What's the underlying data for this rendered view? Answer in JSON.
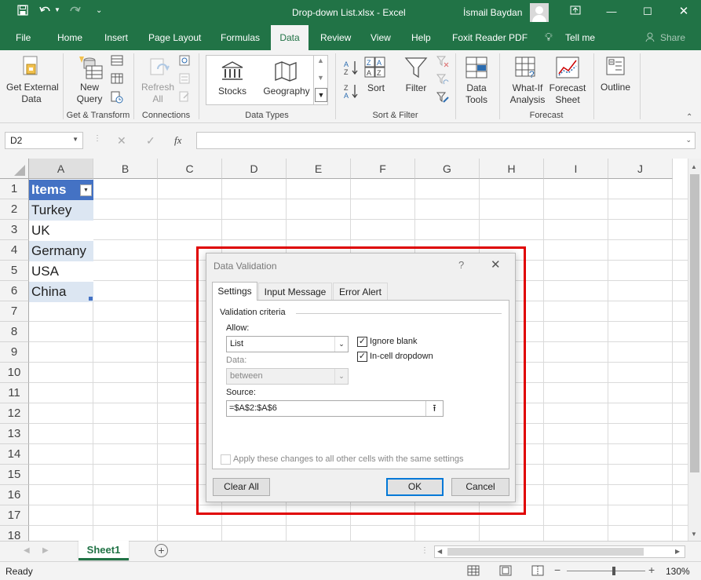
{
  "window": {
    "title": "Drop-down List.xlsx  -  Excel",
    "user": "İsmail Baydan"
  },
  "tabs": [
    "File",
    "Home",
    "Insert",
    "Page Layout",
    "Formulas",
    "Data",
    "Review",
    "View",
    "Help",
    "Foxit Reader PDF",
    "Tell me",
    "Share"
  ],
  "active_tab": "Data",
  "ribbon": {
    "get_external_data": "Get External\nData",
    "new_query": "New\nQuery",
    "refresh_all": "Refresh\nAll",
    "stocks": "Stocks",
    "geography": "Geography",
    "sort": "Sort",
    "filter": "Filter",
    "data_tools": "Data\nTools",
    "what_if": "What-If\nAnalysis",
    "forecast_sheet": "Forecast\nSheet",
    "outline": "Outline",
    "groups": [
      "Get & Transform",
      "Connections",
      "Data Types",
      "Sort & Filter",
      "Forecast"
    ],
    "sort_az": "A Z",
    "sort_za": "Z A"
  },
  "formula_bar": {
    "name_box": "D2",
    "fx": "fx",
    "content": ""
  },
  "columns": [
    "A",
    "B",
    "C",
    "D",
    "E",
    "F",
    "G",
    "H",
    "I",
    "J"
  ],
  "rows": [
    "1",
    "2",
    "3",
    "4",
    "5",
    "6",
    "7",
    "8",
    "9",
    "10",
    "11",
    "12",
    "13",
    "14",
    "15",
    "16",
    "17",
    "18"
  ],
  "cells": {
    "A1": "Items",
    "A2": "Turkey",
    "A3": "UK",
    "A4": "Germany",
    "A5": "USA",
    "A6": "China"
  },
  "sheets": {
    "active": "Sheet1"
  },
  "status": {
    "ready": "Ready",
    "zoom": "130%",
    "zoom_level": 0.6
  },
  "dialog": {
    "title": "Data Validation",
    "help": "?",
    "tabs": [
      "Settings",
      "Input Message",
      "Error Alert"
    ],
    "active_tab": "Settings",
    "section": "Validation criteria",
    "allow_label": "Allow:",
    "allow_value": "List",
    "data_label": "Data:",
    "data_value": "between",
    "ignore_blank": "Ignore blank",
    "ignore_blank_checked": true,
    "in_cell_dropdown": "In-cell dropdown",
    "in_cell_dropdown_checked": true,
    "source_label": "Source:",
    "source_value": "=$A$2:$A$6",
    "apply_all": "Apply these changes to all other cells with the same settings",
    "apply_all_checked": false,
    "clear_all": "Clear All",
    "ok": "OK",
    "cancel": "Cancel"
  },
  "colors": {
    "excel_green": "#217346",
    "table_header": "#4472c4",
    "table_band": "#dce6f2",
    "highlight": "#e00000"
  }
}
